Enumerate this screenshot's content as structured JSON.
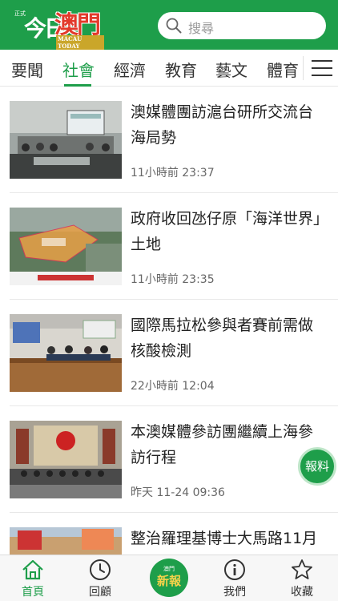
{
  "header": {
    "logo_small": "正式",
    "logo_main": "今日",
    "logo_macau": "澳門",
    "logo_english": "MACAU TODAY",
    "search_placeholder": "搜尋"
  },
  "tabs": [
    {
      "label": "要聞",
      "active": false
    },
    {
      "label": "社會",
      "active": true
    },
    {
      "label": "經濟",
      "active": false
    },
    {
      "label": "教育",
      "active": false
    },
    {
      "label": "藝文",
      "active": false
    },
    {
      "label": "體育",
      "active": false
    }
  ],
  "articles": [
    {
      "title": "澳媒體團訪滬台研所交流台海局勢",
      "time": "11小時前 23:37"
    },
    {
      "title": "政府收回氹仔原「海洋世界」土地",
      "time": "11小時前 23:35"
    },
    {
      "title": "國際馬拉松參與者賽前需做核酸檢測",
      "time": "22小時前 12:04"
    },
    {
      "title": "本澳媒體參訪團繼續上海參訪行程",
      "time": "昨天 11-24 09:36"
    },
    {
      "title": "整治羅理基博士大馬路11月",
      "time": ""
    }
  ],
  "report_button": "報料",
  "bottom_nav": {
    "items": [
      {
        "label": "首頁",
        "icon": "home-icon",
        "active": true
      },
      {
        "label": "回顧",
        "icon": "clock-icon",
        "active": false
      },
      {
        "label": "我們",
        "icon": "info-icon",
        "active": false
      },
      {
        "label": "收藏",
        "icon": "star-icon",
        "active": false
      }
    ],
    "center_small": "澳門",
    "center_big": "新報"
  },
  "colors": {
    "brand_green": "#1e9e4a",
    "logo_red": "#e23a2b"
  }
}
